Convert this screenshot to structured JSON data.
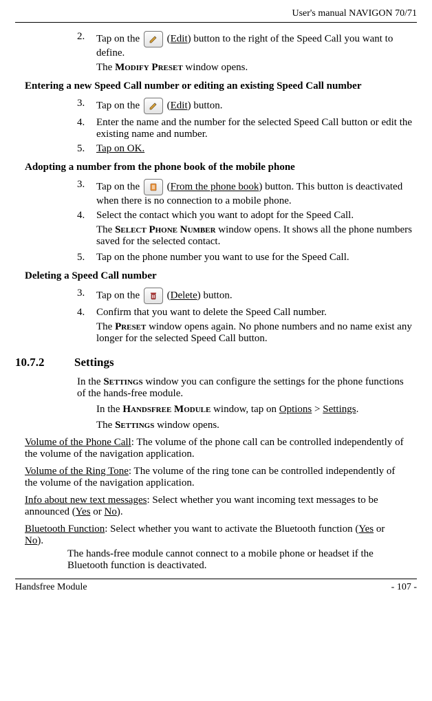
{
  "header": {
    "title": "User's manual NAVIGON 70/71"
  },
  "footer": {
    "left": "Handsfree Module",
    "right": "- 107 -"
  },
  "step2": {
    "num": "2.",
    "pre": "Tap on the ",
    "btn": "Edit",
    "post": ") button to the right of the Speed Call you want to define.",
    "result_pre": "The ",
    "result_sc": "Modify Preset",
    "result_post": " window opens."
  },
  "heading_enter": "Entering a new Speed Call number or editing an existing Speed Call number",
  "step3a": {
    "num": "3.",
    "pre": "Tap on the ",
    "btn": "Edit",
    "post": ") button."
  },
  "step4a": {
    "num": "4.",
    "text": "Enter the name and the number for the selected Speed Call button or edit the existing name and number."
  },
  "step5a": {
    "num": "5.",
    "text": "Tap on OK."
  },
  "heading_adopt": "Adopting a number from the phone book of the mobile phone",
  "step3b": {
    "num": "3.",
    "pre": "Tap on the ",
    "btn": "From the phone book",
    "post": ") button. This button is deactivated when there is no connection to a mobile phone."
  },
  "step4b": {
    "num": "4.",
    "text": "Select the contact which you want to adopt for the Speed Call.",
    "result_pre": "The ",
    "result_sc": "Select Phone Number",
    "result_post": " window opens. It shows all the phone numbers saved for the selected contact."
  },
  "step5b": {
    "num": "5.",
    "text": "Tap on the phone number you want to use for the Speed Call."
  },
  "heading_delete": "Deleting a Speed Call number",
  "step3c": {
    "num": "3.",
    "pre": "Tap on the ",
    "btn": "Delete",
    "post": ") button."
  },
  "step4c": {
    "num": "4.",
    "text": "Confirm that you want to delete the Speed Call number.",
    "result_pre": "The ",
    "result_sc": "Preset",
    "result_post": " window opens again. No phone numbers and no name exist any longer for the selected Speed Call button."
  },
  "section": {
    "num": "10.7.2",
    "title": "Settings"
  },
  "settings_intro": {
    "pre": "In the ",
    "sc": "Settings",
    "post": " window you can configure the settings for the phone functions of the hands-free module."
  },
  "settings_nav": {
    "pre": "In the ",
    "sc": "Handsfree Module",
    "mid": " window, tap on ",
    "u1": "Options",
    "gt": " > ",
    "u2": "Settings",
    "dot": "."
  },
  "settings_opens": {
    "pre": "The ",
    "sc": "Settings",
    "post": " window opens."
  },
  "def1": {
    "term": "Volume of the Phone Call",
    "rest": ": The volume of the phone call can be controlled independently of the volume of the navigation application."
  },
  "def2": {
    "term": "Volume of the Ring Tone",
    "rest": ": The volume of the ring tone can be controlled independently of the volume of the navigation application."
  },
  "def3": {
    "term": "Info about new text messages",
    "rest_a": ": Select whether you want incoming text messages to be announced (",
    "u": "Yes",
    "rest_b": " or ",
    "u2": "No",
    "rest_c": ")."
  },
  "def4": {
    "term": "Bluetooth Function",
    "rest_a": ": Select whether you want to activate the Bluetooth function (",
    "u": "Yes",
    "rest_b": " or ",
    "u2": "No",
    "rest_c": ").",
    "extra": "The hands-free module cannot connect to a mobile phone or headset if the Bluetooth function is deactivated."
  }
}
